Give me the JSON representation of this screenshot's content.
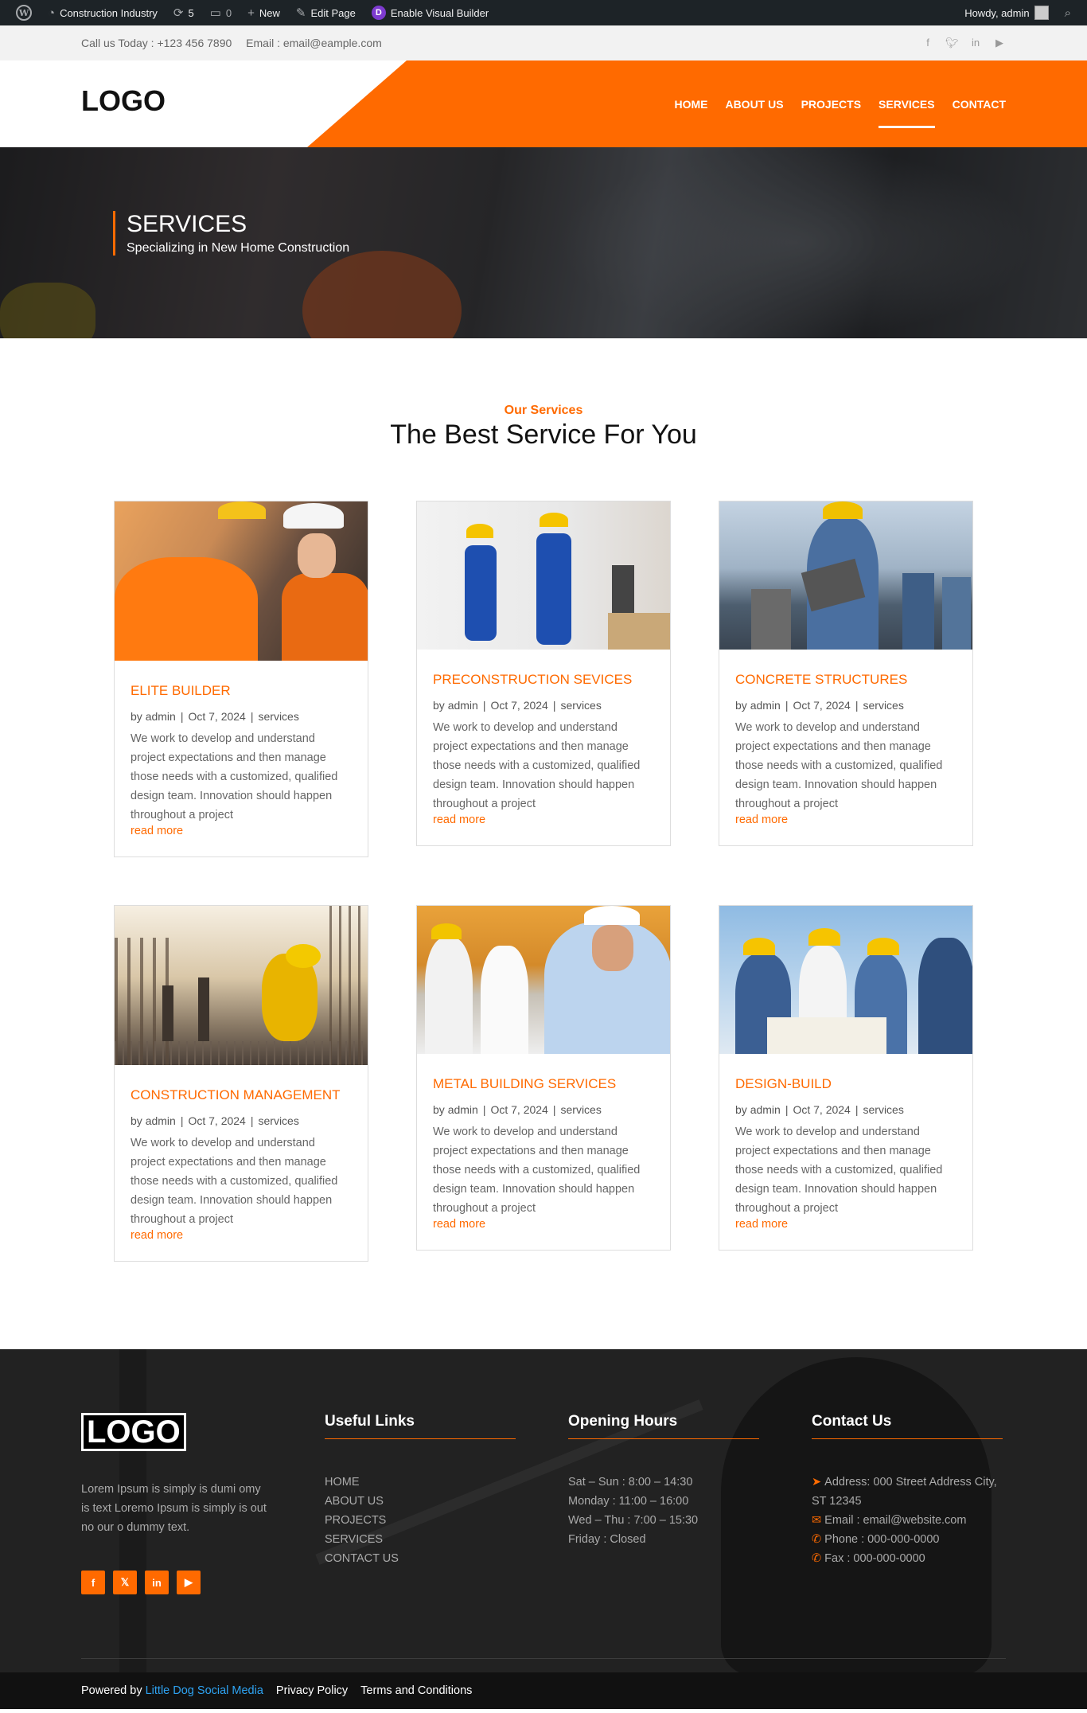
{
  "adminbar": {
    "site": "Construction Industry",
    "updates": "5",
    "comments": "0",
    "new": "New",
    "edit": "Edit Page",
    "visual": "Enable Visual Builder",
    "howdy": "Howdy, admin"
  },
  "topbar": {
    "phone": "Call us Today : +123 456 7890",
    "email": "Email : email@eample.com"
  },
  "header": {
    "logo": "LOGO",
    "nav": [
      "HOME",
      "ABOUT US",
      "PROJECTS",
      "SERVICES",
      "CONTACT"
    ],
    "active": "SERVICES"
  },
  "hero": {
    "title": "SERVICES",
    "subtitle": "Specializing in New Home Construction"
  },
  "services": {
    "kicker": "Our Services",
    "title": "The Best Service For You",
    "cards": [
      {
        "title": "ELITE BUILDER",
        "author": "admin",
        "date": "Oct 7, 2024",
        "category": "services",
        "excerpt": "We work to develop and understand project expectations and then manage those needs with a customized, qualified design team. Innovation should happen throughout a project",
        "readmore": "read more"
      },
      {
        "title": "PRECONSTRUCTION SEVICES",
        "author": "admin",
        "date": "Oct 7, 2024",
        "category": "services",
        "excerpt": "We work to develop and understand project expectations and then manage those needs with a customized, qualified design team. Innovation should happen throughout a project",
        "readmore": "read more"
      },
      {
        "title": "CONCRETE STRUCTURES",
        "author": "admin",
        "date": "Oct 7, 2024",
        "category": "services",
        "excerpt": "We work to develop and understand project expectations and then manage those needs with a customized, qualified design team. Innovation should happen throughout a project",
        "readmore": "read more"
      },
      {
        "title": "CONSTRUCTION MANAGEMENT",
        "author": "admin",
        "date": "Oct 7, 2024",
        "category": "services",
        "excerpt": "We work to develop and understand project expectations and then manage those needs with a customized, qualified design team. Innovation should happen throughout a project",
        "readmore": "read more"
      },
      {
        "title": "METAL BUILDING SERVICES",
        "author": "admin",
        "date": "Oct 7, 2024",
        "category": "services",
        "excerpt": "We work to develop and understand project expectations and then manage those needs with a customized, qualified design team. Innovation should happen throughout a project",
        "readmore": "read more"
      },
      {
        "title": "DESIGN-BUILD",
        "author": "admin",
        "date": "Oct 7, 2024",
        "category": "services",
        "excerpt": "We work to develop and understand project expectations and then manage those needs with a customized, qualified design team. Innovation should happen throughout a project",
        "readmore": "read more"
      }
    ]
  },
  "footer": {
    "logo": "LOGO",
    "about": "Lorem Ipsum is simply is dumi omy is text Loremo Ipsum is simply is out no our o dummy text.",
    "links_title": "Useful Links",
    "links": [
      "HOME",
      "ABOUT US",
      "PROJECTS",
      "SERVICES",
      "CONTACT US"
    ],
    "hours_title": "Opening Hours",
    "hours": [
      "Sat – Sun : 8:00 – 14:30",
      "Monday : 11:00 – 16:00",
      "Wed – Thu : 7:00 – 15:30",
      "Friday : Closed"
    ],
    "contact_title": "Contact Us",
    "address": "Address: 000 Street Address City, ST 12345",
    "email": "Email : email@website.com",
    "phone": "Phone : 000-000-0000",
    "fax": "Fax : 000-000-0000"
  },
  "bottombar": {
    "powered": "Powered by",
    "company": "Little Dog Social Media",
    "privacy": "Privacy Policy",
    "terms": "Terms and Conditions"
  },
  "colors": {
    "accent": "#ff6a00",
    "adminbar": "#1d2327",
    "footer": "#222222"
  }
}
